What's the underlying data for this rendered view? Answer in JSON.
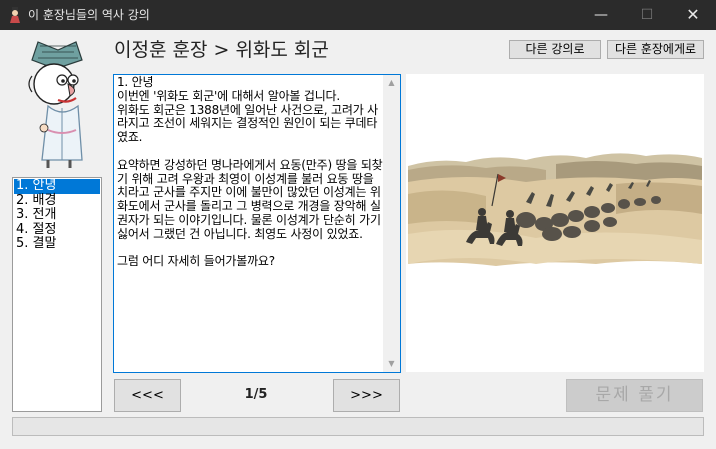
{
  "window": {
    "title": "이 훈장님들의 역사 강의",
    "minimize_glyph": "—",
    "maximize_glyph": "☐",
    "close_glyph": "✕"
  },
  "header": {
    "breadcrumb": "이정훈 훈장 > 위화도 회군",
    "other_lecture_label": "다른 강의로",
    "other_teacher_label": "다른 훈장에게로"
  },
  "lesson_list": {
    "items": [
      {
        "label": "1. 안녕",
        "selected": true
      },
      {
        "label": "2. 배경",
        "selected": false
      },
      {
        "label": "3. 전개",
        "selected": false
      },
      {
        "label": "4. 절정",
        "selected": false
      },
      {
        "label": "5. 결말",
        "selected": false
      }
    ]
  },
  "content": {
    "text": "1. 안녕\n이번엔 '위화도 회군'에 대해서 알아볼 겁니다.\n위화도 회군은 1388년에 일어난 사건으로, 고려가 사라지고 조선이 세워지는 결정적인 원인이 되는 쿠데타였죠.\n\n요약하면 강성하던 명나라에게서 요동(만주) 땅을 되찾기 위해 고려 우왕과 최영이 이성계를 불러 요동 땅을 치라고 군사를 주지만 이에 불만이 많았던 이성계는 위화도에서 군사를 돌리고 그 병력으로 개경을 장악해 실권자가 되는 이야기입니다. 물론 이성계가 단순히 가기 싫어서 그랬던 건 아닙니다. 최영도 사정이 있었죠.\n\n그럼 어디 자세히 들어가볼까요?"
  },
  "navigation": {
    "prev_label": "<<<",
    "next_label": ">>>",
    "page_indicator": "1/5",
    "quiz_label": "문제 풀기"
  },
  "colors": {
    "titlebar": "#2b2b2b",
    "selection": "#0078d7",
    "window_bg": "#f0f0f0"
  },
  "icons": {
    "app": "scholar-icon",
    "mascot": "scholar-mascot",
    "illustration": "army-retreat-illustration"
  }
}
